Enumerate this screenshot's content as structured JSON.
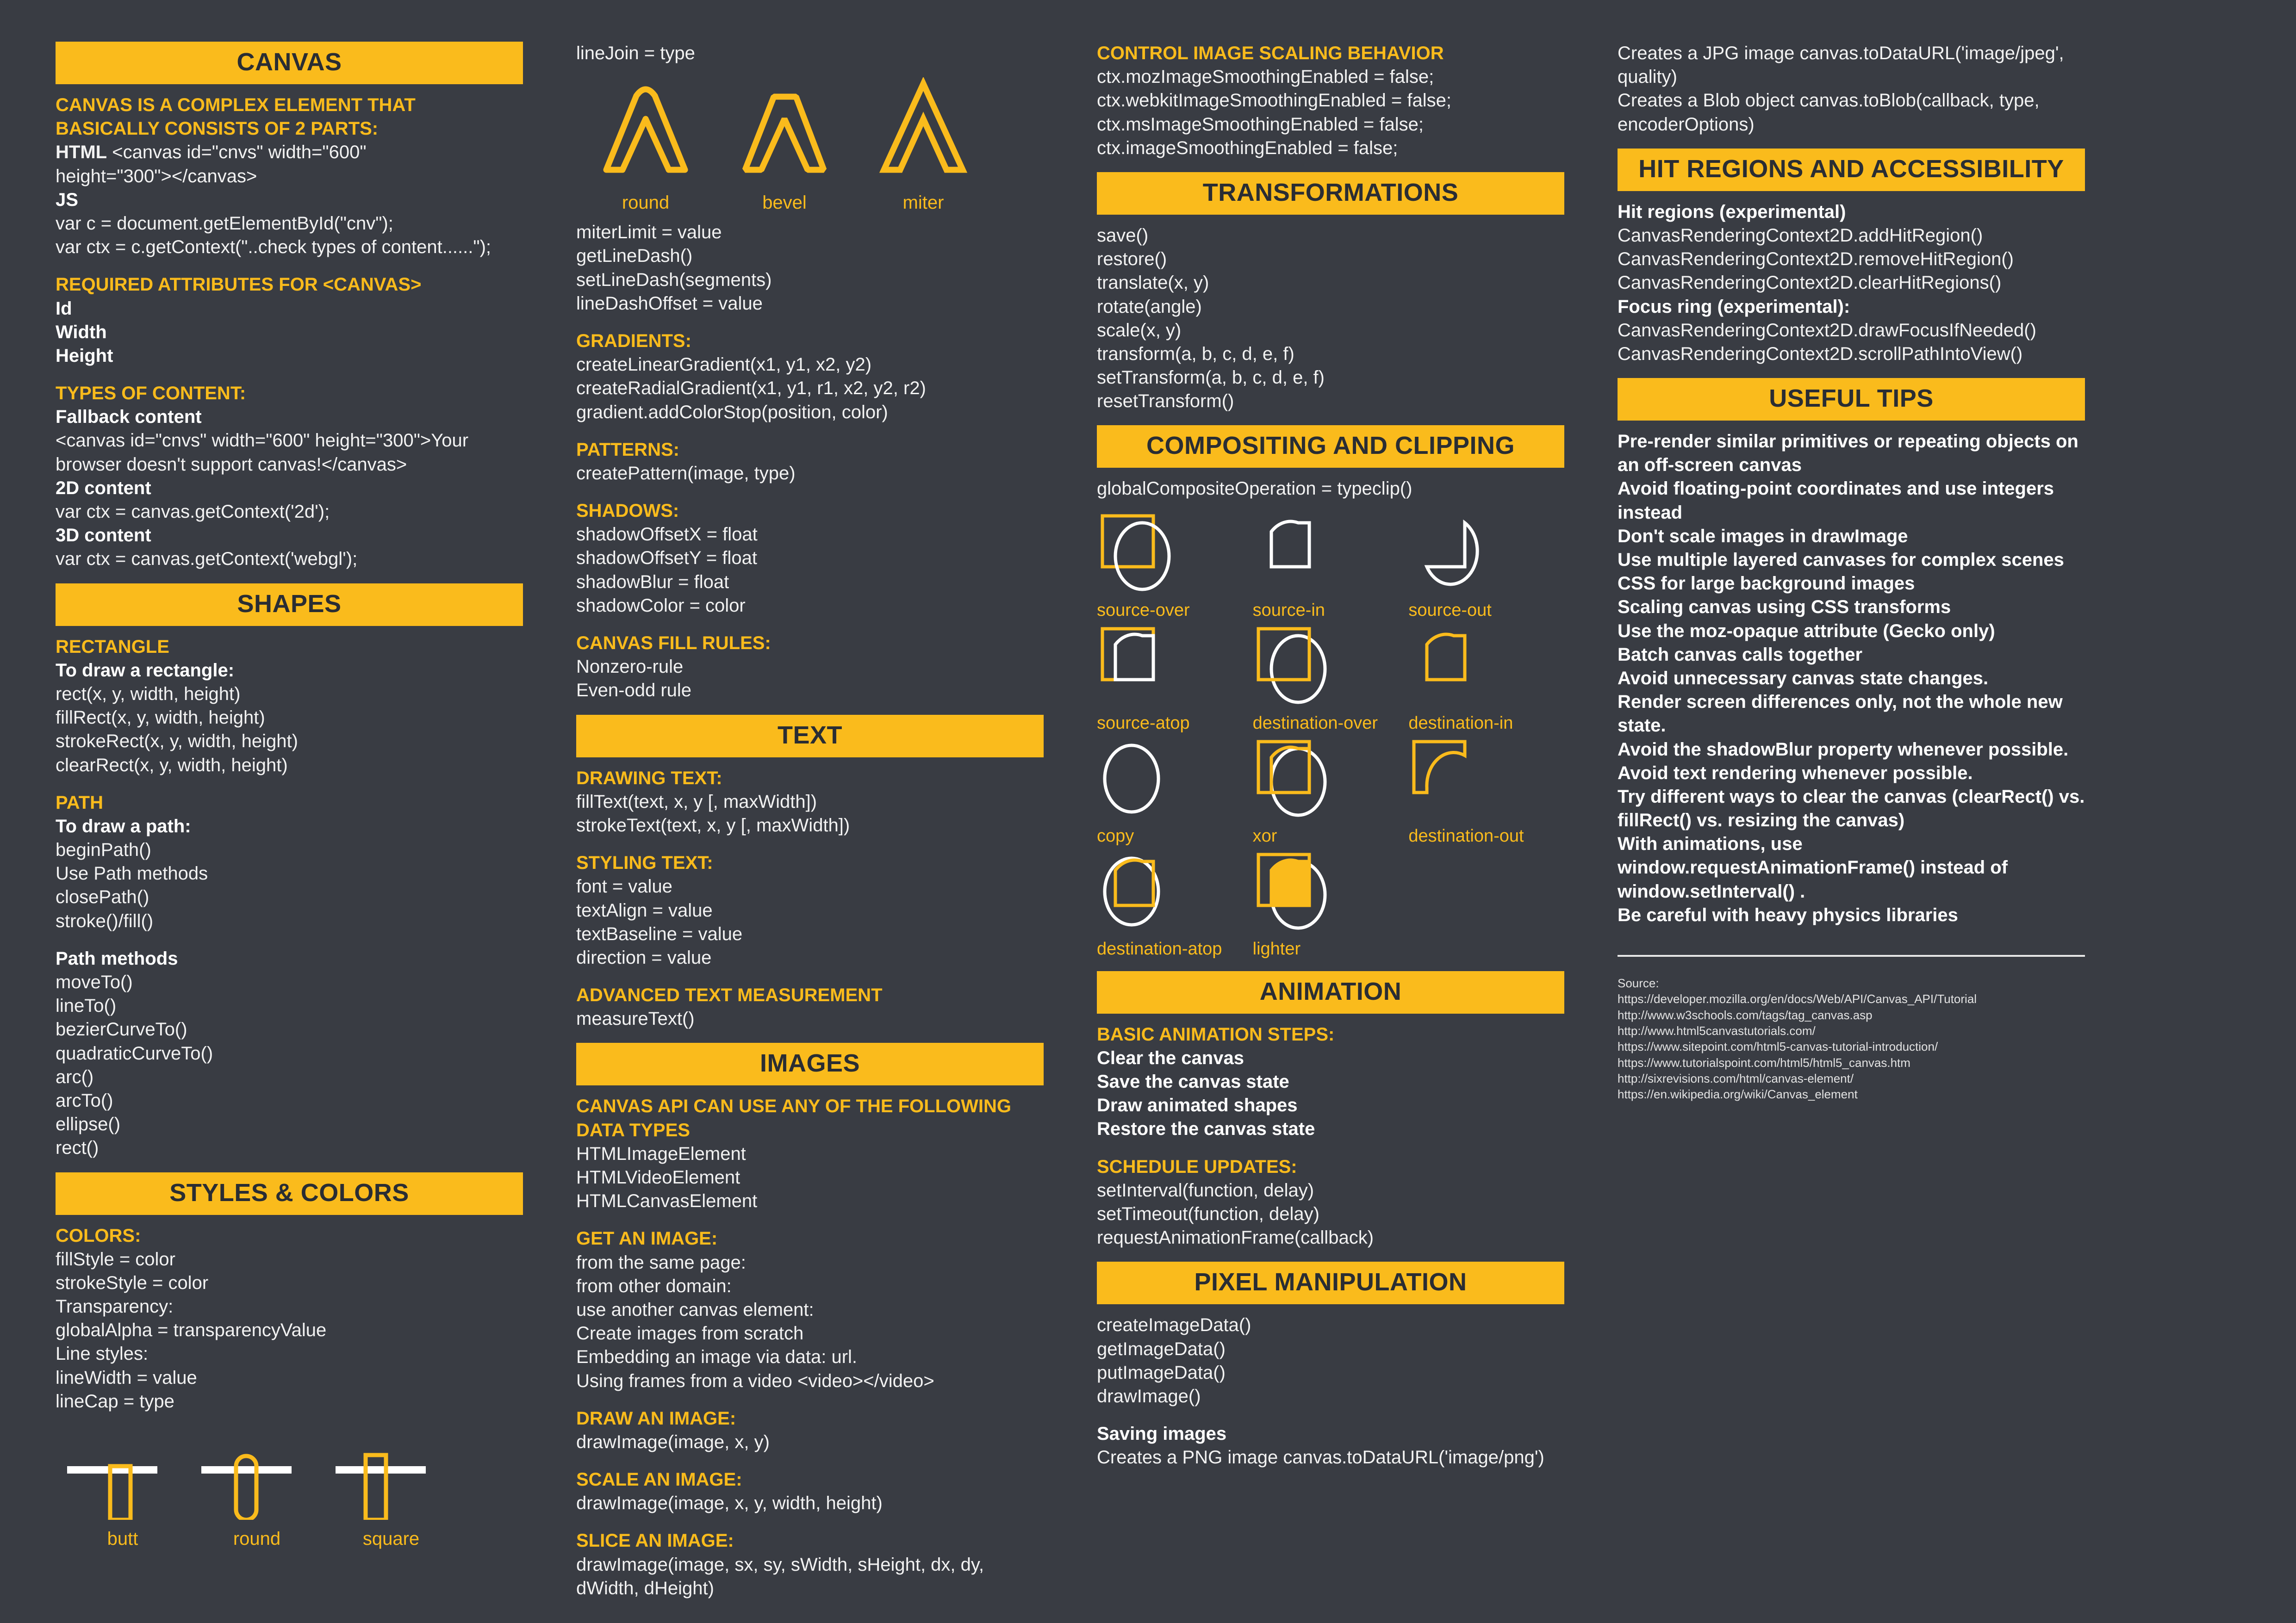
{
  "theme": {
    "background": "#393c43",
    "accent": "#fabb1c",
    "text": "#f2f2f2",
    "bar_text": "#2a2d33"
  },
  "col1": {
    "canvas_header": "CANVAS",
    "intro_title": "CANVAS IS A COMPLEX ELEMENT THAT BASICALLY CONSISTS OF 2 PARTS:",
    "html_label": "HTML",
    "html_code1": "<canvas id=\"cnvs\" width=\"600\"",
    "html_code2": "height=\"300\"></canvas>",
    "js_label": "JS",
    "js_line1": "var c = document.getElementById(\"cnv\");",
    "js_line2": "var ctx = c.getContext(\"..check types of content......\");",
    "required_title": "REQUIRED ATTRIBUTES FOR <CANVAS>",
    "required": [
      "Id",
      "Width",
      "Height"
    ],
    "types_title": "TYPES OF CONTENT:",
    "fallback_label": "Fallback content",
    "fallback_code1": "<canvas id=\"cnvs\" width=\"600\" height=\"300\">Your",
    "fallback_code2": "browser doesn't support canvas!</canvas>",
    "twod_label": "2D content",
    "twod_code": "var ctx = canvas.getContext('2d');",
    "threed_label": "3D content",
    "threed_code": "var ctx = canvas.getContext('webgl');",
    "shapes_header": "SHAPES",
    "rectangle_title": "RECTANGLE",
    "rectangle_sub": "To draw a rectangle:",
    "rectangle_methods": [
      "rect(x, y, width, height)",
      "fillRect(x, y, width, height)",
      "strokeRect(x, y, width, height)",
      "clearRect(x, y, width, height)"
    ],
    "path_title": "PATH",
    "path_sub": "To draw a path:",
    "path_steps": [
      "beginPath()",
      "Use Path methods",
      "closePath()",
      "stroke()/fill()"
    ],
    "path_methods_title": "Path methods",
    "path_methods": [
      "moveTo()",
      "lineTo()",
      "bezierCurveTo()",
      "quadraticCurveTo()",
      "arc()",
      "arcTo()",
      "ellipse()",
      "rect()"
    ],
    "styles_header": "STYLES & COLORS",
    "colors_title": "COLORS:",
    "colors_lines": [
      "fillStyle = color",
      "strokeStyle = color",
      "Transparency:",
      "globalAlpha = transparencyValue",
      "Line styles:",
      "lineWidth = value",
      "lineCap = type"
    ],
    "linecap_labels": [
      "butt",
      "round",
      "square"
    ]
  },
  "col2": {
    "linejoin_line": "lineJoin = type",
    "linejoin_labels": [
      "round",
      "bevel",
      "miter"
    ],
    "line_props": [
      "miterLimit = value",
      "getLineDash()",
      "setLineDash(segments)",
      "lineDashOffset = value"
    ],
    "gradients_title": "GRADIENTS:",
    "gradients": [
      "createLinearGradient(x1, y1, x2, y2)",
      "createRadialGradient(x1, y1, r1, x2, y2, r2)",
      "gradient.addColorStop(position, color)"
    ],
    "patterns_title": "PATTERNS:",
    "patterns": [
      "createPattern(image, type)"
    ],
    "shadows_title": "SHADOWS:",
    "shadows": [
      "shadowOffsetX = float",
      "shadowOffsetY = float",
      "shadowBlur = float",
      "shadowColor = color"
    ],
    "fillrules_title": "CANVAS FILL RULES:",
    "fillrules": [
      "Nonzero-rule",
      "Even-odd rule"
    ],
    "text_header": "TEXT",
    "drawing_text_title": "DRAWING TEXT:",
    "drawing_text": [
      "fillText(text, x, y [, maxWidth])",
      "strokeText(text, x, y [, maxWidth])"
    ],
    "styling_text_title": "STYLING TEXT:",
    "styling_text": [
      "font = value",
      "textAlign = value",
      "textBaseline = value",
      "direction = value"
    ],
    "measure_title": "ADVANCED TEXT MEASUREMENT",
    "measure": [
      "measureText()"
    ],
    "images_header": "IMAGES",
    "datatypes_title": "CANVAS API CAN USE ANY OF THE FOLLOWING DATA TYPES",
    "datatypes": [
      "HTMLImageElement",
      "HTMLVideoElement",
      "HTMLCanvasElement"
    ],
    "get_image_title": "GET AN IMAGE:",
    "get_image": [
      {
        "bold": "from the same page:",
        "rest": ""
      },
      {
        "bold": "from other domain:",
        "rest": ""
      },
      {
        "bold": "use another canvas element:",
        "rest": ""
      },
      {
        "bold": "Create images from scratch",
        "rest": ""
      },
      {
        "bold": "Embedding an image via",
        "rest": " data: url."
      },
      {
        "bold": "Using frames from a video <video></video>",
        "rest": ""
      }
    ],
    "draw_image_title": "DRAW AN IMAGE:",
    "draw_image": [
      "drawImage(image, x, y)"
    ],
    "scale_image_title": "SCALE AN IMAGE:",
    "scale_image": [
      "drawImage(image, x, y, width, height)"
    ],
    "slice_image_title": "SLICE AN IMAGE:",
    "slice_image": [
      "drawImage(image, sx, sy, sWidth, sHeight, dx, dy, dWidth, dHeight)"
    ]
  },
  "col3": {
    "scaling_title": "CONTROL IMAGE SCALING BEHAVIOR",
    "scaling": [
      "ctx.mozImageSmoothingEnabled = false;",
      "ctx.webkitImageSmoothingEnabled = false;",
      "ctx.msImageSmoothingEnabled = false;",
      "ctx.imageSmoothingEnabled = false;"
    ],
    "transformations_header": "TRANSFORMATIONS",
    "transformations": [
      "save()",
      "restore()",
      "translate(x, y)",
      "rotate(angle)",
      "scale(x, y)",
      "transform(a, b, c, d, e, f)",
      "setTransform(a, b, c, d, e, f)",
      "resetTransform()"
    ],
    "compositing_header": "COMPOSITING AND CLIPPING",
    "composite_line": "globalCompositeOperation = typeclip()",
    "composite_modes": [
      "source-over",
      "source-in",
      "source-out",
      "source-atop",
      "destination-over",
      "destination-in",
      "copy",
      "xor",
      "destination-out",
      "destination-atop",
      "lighter"
    ],
    "animation_header": "ANIMATION",
    "basic_steps_title": "BASIC ANIMATION STEPS:",
    "basic_steps": [
      "Clear the canvas",
      "Save the canvas state",
      "Draw animated shapes",
      "Restore the canvas state"
    ],
    "schedule_title": "SCHEDULE UPDATES:",
    "schedule": [
      "setInterval(function, delay)",
      "setTimeout(function, delay)",
      "requestAnimationFrame(callback)"
    ],
    "pixel_header": "PIXEL MANIPULATION",
    "pixel": [
      "createImageData()",
      "getImageData()",
      "putImageData()",
      "drawImage()"
    ],
    "saving_title": "Saving images",
    "saving_png": "Creates a PNG image canvas.toDataURL('image/png')"
  },
  "col4": {
    "saving_jpg": "Creates a JPG image canvas.toDataURL('image/jpeg', quality)",
    "saving_blob": "Creates a Blob object canvas.toBlob(callback, type, encoderOptions)",
    "hit_header": "HIT REGIONS AND ACCESSIBILITY",
    "hit_title": "Hit regions (experimental)",
    "hit_methods": [
      "CanvasRenderingContext2D.addHitRegion()",
      "CanvasRenderingContext2D.removeHitRegion()",
      "CanvasRenderingContext2D.clearHitRegions()"
    ],
    "focus_title": " Focus ring (experimental):",
    "focus_methods": [
      "CanvasRenderingContext2D.drawFocusIfNeeded()",
      "CanvasRenderingContext2D.scrollPathIntoView()"
    ],
    "tips_header": "USEFUL TIPS",
    "tips": [
      "Pre-render similar primitives or repeating objects on an off-screen canvas",
      "Avoid floating-point coordinates and use integers instead",
      "Don't scale images in drawImage",
      "Use multiple layered canvases for complex scenes",
      "CSS for large background images",
      "Scaling canvas using CSS transforms",
      "Use the moz-opaque attribute (Gecko only)",
      "Batch canvas calls together",
      "Avoid unnecessary canvas state changes.",
      "Render screen differences only, not the whole new state.",
      "Avoid the shadowBlur property whenever possible.",
      "Avoid text rendering whenever possible.",
      "Try different ways to clear the canvas (clearRect() vs. fillRect() vs. resizing the canvas)",
      "With animations, use window.requestAnimationFrame() instead of window.setInterval() .",
      "Be careful with heavy physics libraries"
    ],
    "source_title": "Source:",
    "sources": [
      "https://developer.mozilla.org/en/docs/Web/API/Canvas_API/Tutorial",
      "http://www.w3schools.com/tags/tag_canvas.asp",
      "http://www.html5canvastutorials.com/",
      "https://www.sitepoint.com/html5-canvas-tutorial-introduction/",
      "https://www.tutorialspoint.com/html5/html5_canvas.htm",
      "http://sixrevisions.com/html/canvas-element/",
      "https://en.wikipedia.org/wiki/Canvas_element"
    ]
  }
}
